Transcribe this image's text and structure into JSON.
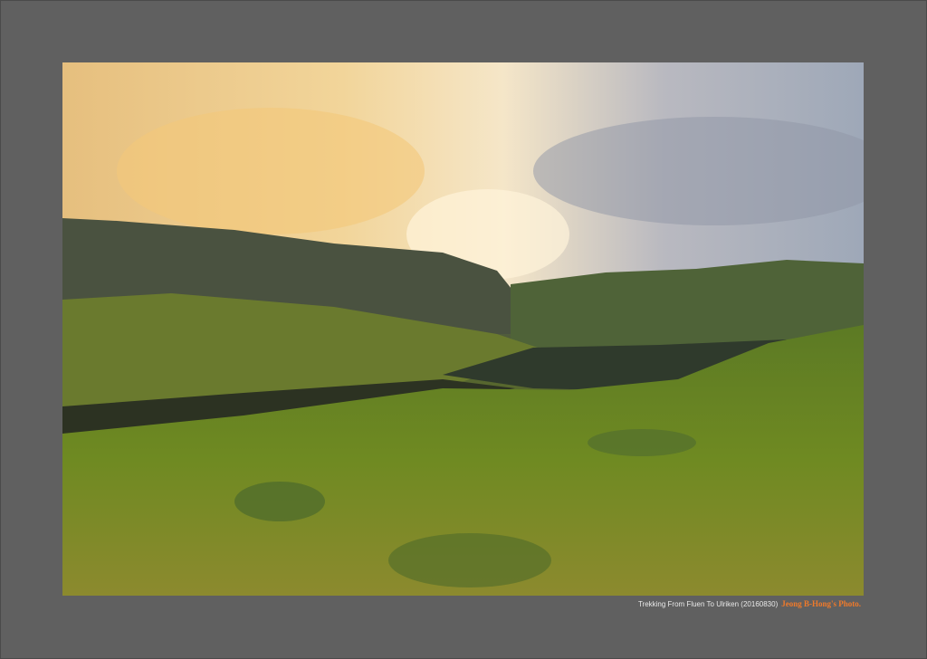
{
  "caption": {
    "title": "Trekking From Fluen To Ulriken (20160830)",
    "credit": "Jeong B-Hong's Photo."
  },
  "colors": {
    "frame": "#606060",
    "credit": "#f07a2a"
  }
}
